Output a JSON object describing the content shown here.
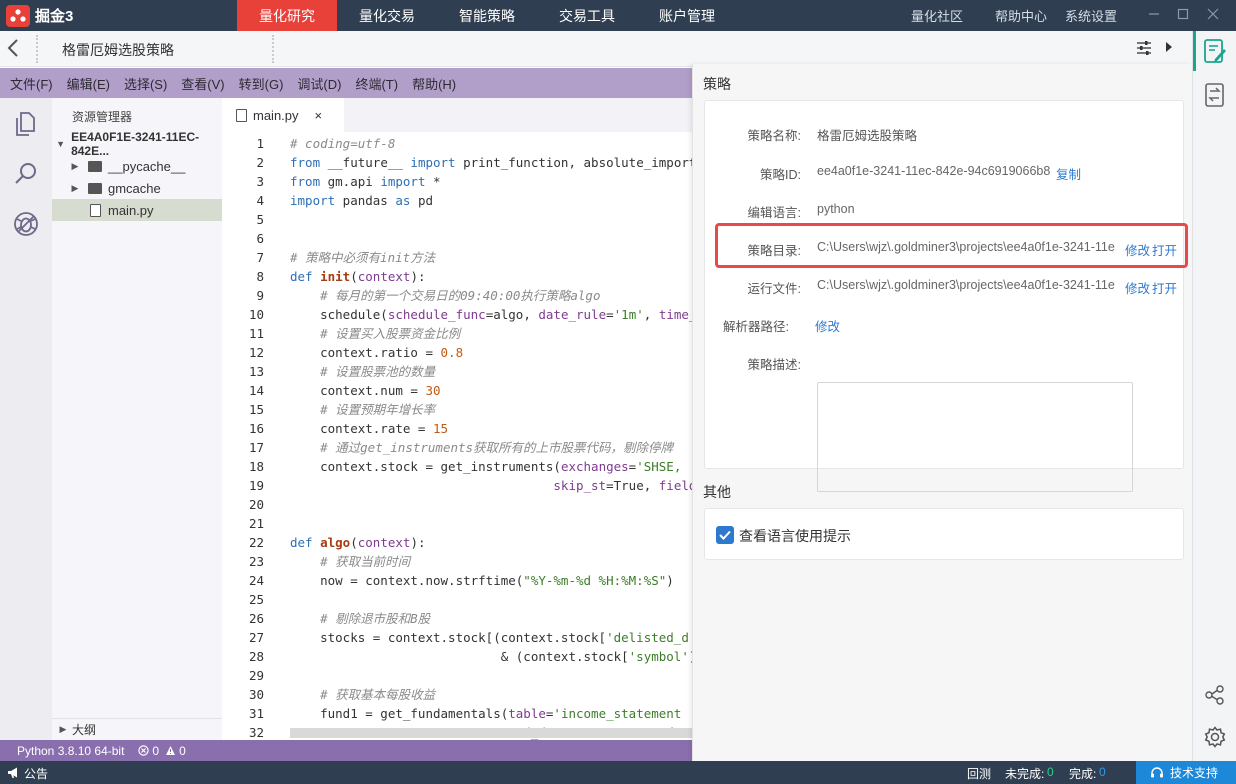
{
  "app": {
    "name": "掘金3"
  },
  "nav": {
    "tabs": [
      {
        "label": "量化研究",
        "active": true
      },
      {
        "label": "量化交易",
        "active": false
      },
      {
        "label": "智能策略",
        "active": false
      },
      {
        "label": "交易工具",
        "active": false
      },
      {
        "label": "账户管理",
        "active": false
      }
    ],
    "right": [
      "量化社区",
      "帮助中心",
      "系统设置"
    ]
  },
  "header": {
    "strategy_title": "格雷厄姆选股策略"
  },
  "menu": {
    "items": [
      "文件(F)",
      "编辑(E)",
      "选择(S)",
      "查看(V)",
      "转到(G)",
      "调试(D)",
      "终端(T)",
      "帮助(H)"
    ]
  },
  "explorer": {
    "title": "资源管理器",
    "project": "EE4A0F1E-3241-11EC-842E...",
    "items": [
      {
        "name": "__pycache__",
        "type": "folder"
      },
      {
        "name": "gmcache",
        "type": "folder"
      },
      {
        "name": "main.py",
        "type": "file",
        "selected": true
      }
    ],
    "outline": "大纲"
  },
  "editor": {
    "tab": "main.py",
    "close": "×",
    "line_numbers": [
      "1",
      "2",
      "3",
      "4",
      "5",
      "6",
      "7",
      "8",
      "9",
      "10",
      "11",
      "12",
      "13",
      "14",
      "15",
      "16",
      "17",
      "18",
      "19",
      "20",
      "21",
      "22",
      "23",
      "24",
      "25",
      "26",
      "27",
      "28",
      "29",
      "30",
      "31",
      "32"
    ]
  },
  "statusbar": {
    "python": "Python 3.8.10 64-bit",
    "errors": "0",
    "warnings": "0"
  },
  "panel": {
    "section_strategy": "策略",
    "name_label": "策略名称:",
    "name_value": "格雷厄姆选股策略",
    "id_label": "策略ID:",
    "id_value": "ee4a0f1e-3241-11ec-842e-94c6919066b8",
    "copy": "复制",
    "lang_label": "编辑语言:",
    "lang_value": "python",
    "dir_label": "策略目录:",
    "dir_value": "C:\\Users\\wjz\\.goldminer3\\projects\\ee4a0f1e-3241-11e",
    "modify": "修改",
    "open": "打开",
    "run_label": "运行文件:",
    "run_value": "C:\\Users\\wjz\\.goldminer3\\projects\\ee4a0f1e-3241-11e",
    "parser_label": "解析器路径:",
    "parser_modify": "修改",
    "desc_label": "策略描述:",
    "section_other": "其他",
    "hint_label": "查看语言使用提示",
    "hint_checked": true
  },
  "bottombar": {
    "notice": "公告",
    "backtest": "回测",
    "incomplete_label": "未完成:",
    "incomplete_value": "0",
    "complete_label": "完成:",
    "complete_value": "0",
    "support": "技术支持"
  },
  "colors": {
    "topbar": "#2f3e50",
    "active_tab": "#e8413a",
    "menubar": "#b19ec9",
    "statusbar": "#8a6fae",
    "link": "#2d79cf",
    "highlight": "#e64a4a"
  }
}
